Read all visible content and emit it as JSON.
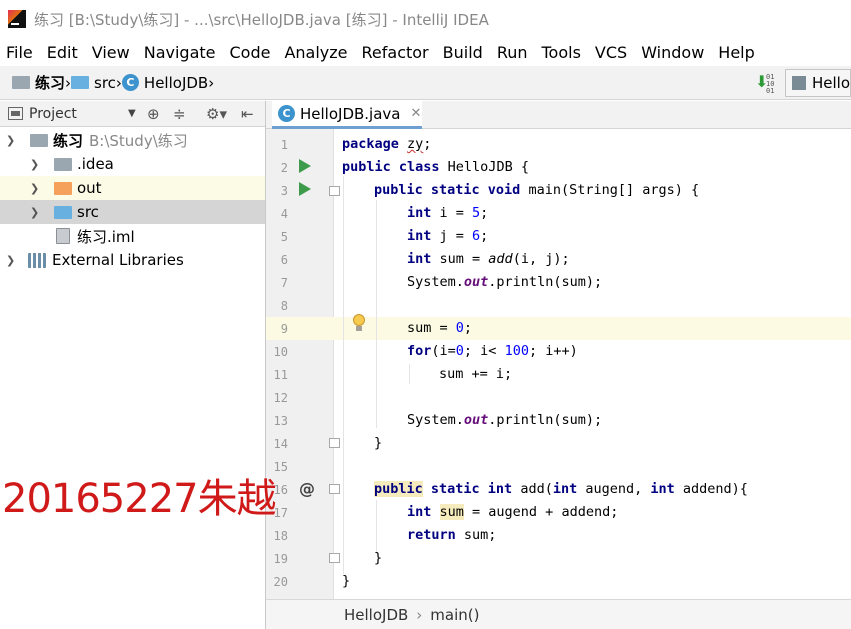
{
  "window": {
    "title": "练习 [B:\\Study\\练习] - ...\\src\\HelloJDB.java [练习] - IntelliJ IDEA"
  },
  "menu": [
    "File",
    "Edit",
    "View",
    "Navigate",
    "Code",
    "Analyze",
    "Refactor",
    "Build",
    "Run",
    "Tools",
    "VCS",
    "Window",
    "Help"
  ],
  "navbar": {
    "crumbs": [
      "练习",
      "src",
      "HelloJDB"
    ],
    "run_config": "Hello"
  },
  "project_panel": {
    "title": "Project",
    "tree": [
      {
        "label": "练习",
        "path": "B:\\Study\\练习"
      },
      {
        "label": ".idea"
      },
      {
        "label": "out"
      },
      {
        "label": "src"
      },
      {
        "label": "练习.iml"
      },
      {
        "label": "External Libraries"
      }
    ]
  },
  "editor": {
    "tab": "HelloJDB.java",
    "line_numbers": [
      "1",
      "2",
      "3",
      "4",
      "5",
      "6",
      "7",
      "8",
      "9",
      "10",
      "11",
      "12",
      "13",
      "14",
      "15",
      "16",
      "17",
      "18",
      "19",
      "20"
    ],
    "lines": {
      "l1": {
        "a": "package ",
        "b": "zy",
        "c": ";"
      },
      "l2": {
        "a": "public class ",
        "b": "HelloJDB {"
      },
      "l3": {
        "a": "public static void ",
        "b": "main(String[] args) {"
      },
      "l4": {
        "a": "int ",
        "b": "i = ",
        "c": "5",
        "d": ";"
      },
      "l5": {
        "a": "int ",
        "b": "j = ",
        "c": "6",
        "d": ";"
      },
      "l6": {
        "a": "int ",
        "b": "sum = ",
        "c": "add",
        "d": "(i, j);"
      },
      "l7": {
        "a": "System.",
        "b": "out",
        "c": ".println(sum);"
      },
      "l9": {
        "a": "sum = ",
        "b": "0",
        "c": ";"
      },
      "l10": {
        "a": "for",
        "b": "(i=",
        "c": "0",
        "d": "; i< ",
        "e": "100",
        "f": "; i++)"
      },
      "l11": {
        "a": "sum += i;"
      },
      "l13": {
        "a": "System.",
        "b": "out",
        "c": ".println(sum);"
      },
      "l14": {
        "a": "}"
      },
      "l16": {
        "a": "public static int ",
        "b": "add(",
        "c": "int ",
        "d": "augend, ",
        "e": "int ",
        "f": "addend){",
        "pub": "public"
      },
      "l17": {
        "a": "int ",
        "b": "sum",
        "c": " = augend + addend;"
      },
      "l18": {
        "a": "return ",
        "b": "sum;"
      },
      "l19": {
        "a": "}"
      },
      "l20": {
        "a": "}"
      }
    }
  },
  "breadcrumb_bottom": [
    "HelloJDB",
    "main()"
  ],
  "watermark": "20165227朱越",
  "colors": {
    "keyword": "#000080",
    "number": "#0000ff",
    "field": "#660e7a",
    "run_gutter": "#3e9b4b",
    "watermark": "#d01919"
  }
}
